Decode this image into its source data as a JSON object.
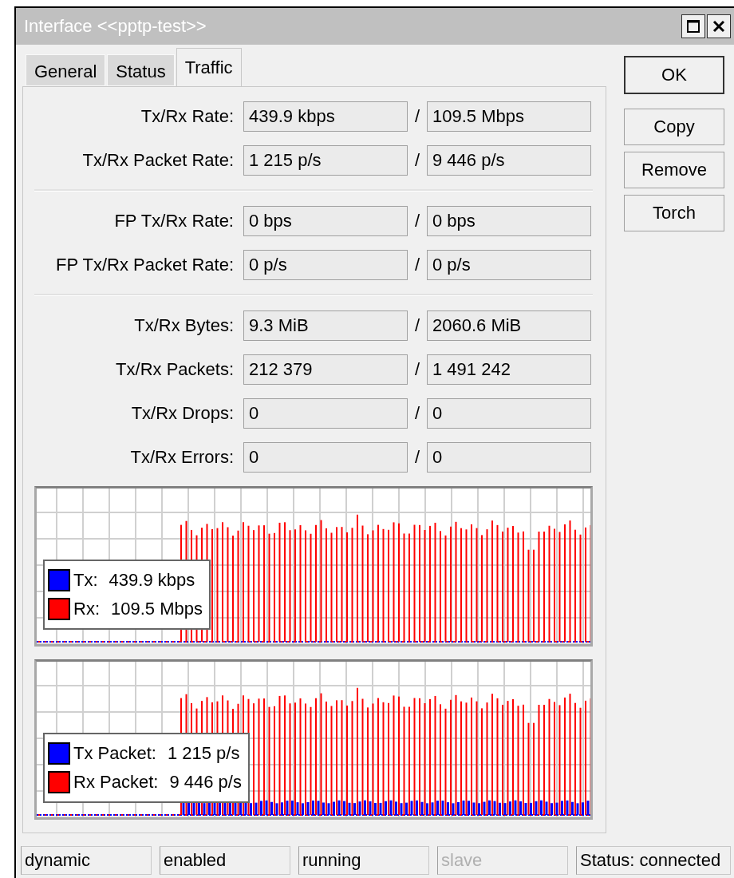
{
  "window": {
    "title": "Interface <<pptp-test>>"
  },
  "tabs": [
    {
      "label": "General",
      "selected": false
    },
    {
      "label": "Status",
      "selected": false
    },
    {
      "label": "Traffic",
      "selected": true
    }
  ],
  "field_groups": [
    [
      {
        "label": "Tx/Rx Rate:",
        "tx": "439.9 kbps",
        "rx": "109.5 Mbps"
      },
      {
        "label": "Tx/Rx Packet Rate:",
        "tx": "1 215 p/s",
        "rx": "9 446 p/s"
      }
    ],
    [
      {
        "label": "FP Tx/Rx Rate:",
        "tx": "0 bps",
        "rx": "0 bps"
      },
      {
        "label": "FP Tx/Rx Packet Rate:",
        "tx": "0 p/s",
        "rx": "0 p/s"
      }
    ],
    [
      {
        "label": "Tx/Rx Bytes:",
        "tx": "9.3 MiB",
        "rx": "2060.6 MiB"
      },
      {
        "label": "Tx/Rx Packets:",
        "tx": "212 379",
        "rx": "1 491 242"
      },
      {
        "label": "Tx/Rx Drops:",
        "tx": "0",
        "rx": "0"
      },
      {
        "label": "Tx/Rx Errors:",
        "tx": "0",
        "rx": "0"
      }
    ]
  ],
  "separator": "/",
  "graphs": [
    {
      "legend": [
        {
          "label": "Tx:",
          "value": "439.9 kbps",
          "color": "#0000ff"
        },
        {
          "label": "Rx:",
          "value": "109.5 Mbps",
          "color": "#ff0000"
        }
      ]
    },
    {
      "legend": [
        {
          "label": "Tx Packet:",
          "value": "1 215 p/s",
          "color": "#0000ff"
        },
        {
          "label": "Rx Packet:",
          "value": "9 446 p/s",
          "color": "#ff0000"
        }
      ]
    }
  ],
  "buttons": [
    {
      "label": "OK",
      "default": true
    },
    {
      "label": "Copy",
      "default": false
    },
    {
      "label": "Remove",
      "default": false
    },
    {
      "label": "Torch",
      "default": false
    }
  ],
  "status_bar": [
    {
      "text": "dynamic",
      "disabled": false
    },
    {
      "text": "enabled",
      "disabled": false
    },
    {
      "text": "running",
      "disabled": false
    },
    {
      "text": "slave",
      "disabled": true
    },
    {
      "text": "Status: connected",
      "disabled": false
    }
  ]
}
